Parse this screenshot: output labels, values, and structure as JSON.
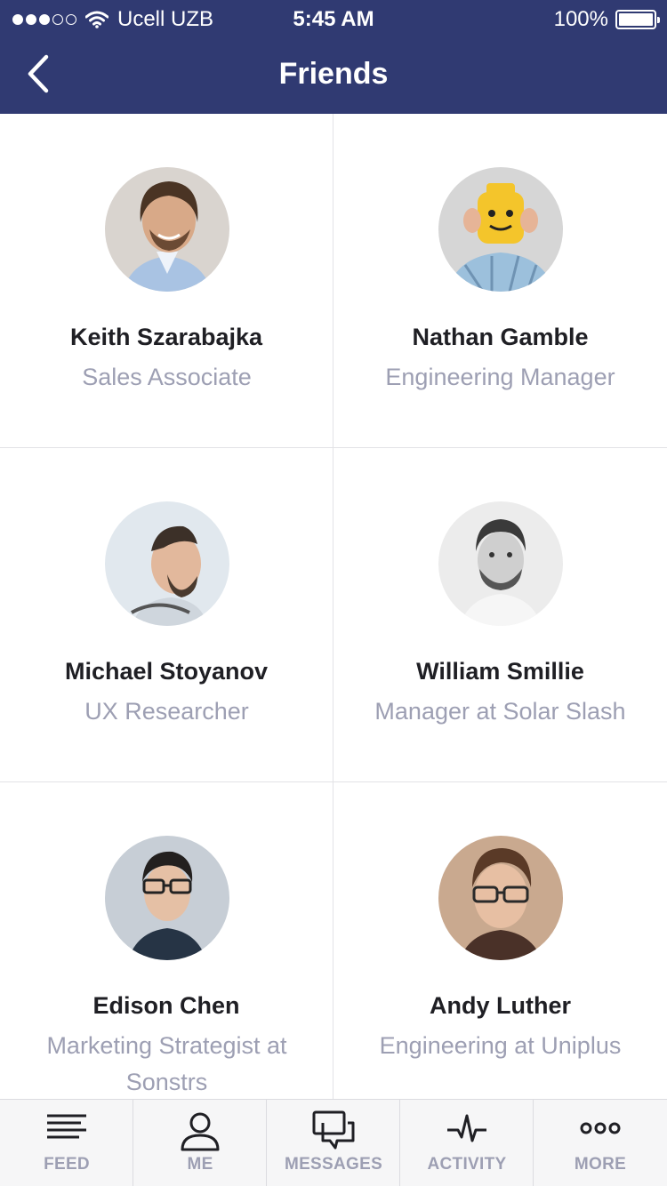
{
  "status_bar": {
    "carrier": "Ucell UZB",
    "time": "5:45 AM",
    "battery": "100%"
  },
  "nav": {
    "title": "Friends",
    "back_icon": "chevron-left-icon"
  },
  "friends": [
    {
      "name": "Keith Szarabajka",
      "role": "Sales Associate"
    },
    {
      "name": "Nathan Gamble",
      "role": "Engineering Manager"
    },
    {
      "name": "Michael Stoyanov",
      "role": "UX Researcher"
    },
    {
      "name": "William Smillie",
      "role": "Manager at Solar Slash"
    },
    {
      "name": "Edison Chen",
      "role": "Marketing Strategist at Sonstrs"
    },
    {
      "name": "Andy Luther",
      "role": "Engineering at Uniplus"
    }
  ],
  "tabs": [
    {
      "label": "FEED",
      "icon": "feed-lines-icon"
    },
    {
      "label": "ME",
      "icon": "person-icon"
    },
    {
      "label": "MESSAGES",
      "icon": "chat-bubbles-icon"
    },
    {
      "label": "ACTIVITY",
      "icon": "pulse-icon"
    },
    {
      "label": "MORE",
      "icon": "more-dots-icon"
    }
  ],
  "colors": {
    "header": "#303a72",
    "secondary_text": "#9d9fb3",
    "divider": "#e3e3e6"
  }
}
